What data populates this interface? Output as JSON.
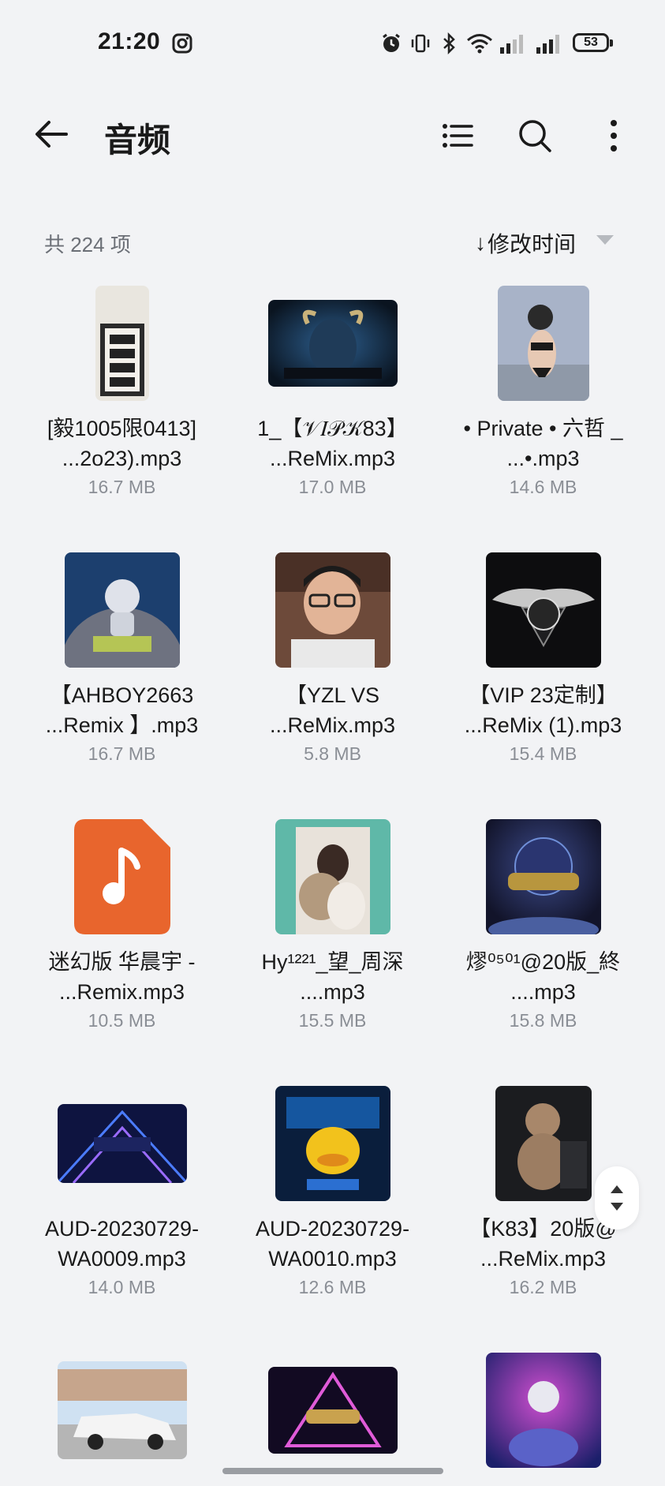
{
  "status": {
    "time": "21:20",
    "battery": "53"
  },
  "header": {
    "title": "音频"
  },
  "list": {
    "count_label": "共 224 项",
    "sort_label": "修改时间",
    "sort_arrow": "↓"
  },
  "items": [
    {
      "line1": "[毅1005限0413]",
      "line2": "...2o23).mp3",
      "size": "16.7 MB",
      "thumb": "photo"
    },
    {
      "line1": "1_【𝒱𝐼𝒫𝒦83】",
      "line2": "...ReMix.mp3",
      "size": "17.0 MB",
      "thumb": "art"
    },
    {
      "line1": "• Private • 六哲 _",
      "line2": "...•.mp3",
      "size": "14.6 MB",
      "thumb": "photo"
    },
    {
      "line1": "【AHBOY2663",
      "line2": "...Remix 】.mp3",
      "size": "16.7 MB",
      "thumb": "art"
    },
    {
      "line1": "【YZL VS",
      "line2": "...ReMix.mp3",
      "size": "5.8 MB",
      "thumb": "photo"
    },
    {
      "line1": "【VIP 23定制】",
      "line2": "...ReMix (1).mp3",
      "size": "15.4 MB",
      "thumb": "art"
    },
    {
      "line1": "迷幻版 华晨宇 -",
      "line2": "...Remix.mp3",
      "size": "10.5 MB",
      "thumb": "music-file-icon"
    },
    {
      "line1": "Hy¹²²¹_望_周深",
      "line2": "....mp3",
      "size": "15.5 MB",
      "thumb": "photo"
    },
    {
      "line1": "熮⁰⁵⁰¹@20版_終",
      "line2": "....mp3",
      "size": "15.8 MB",
      "thumb": "art"
    },
    {
      "line1": "AUD-20230729-",
      "line2": "WA0009.mp3",
      "size": "14.0 MB",
      "thumb": "art"
    },
    {
      "line1": "AUD-20230729-",
      "line2": "WA0010.mp3",
      "size": "12.6 MB",
      "thumb": "art"
    },
    {
      "line1": "【K83】20版@",
      "line2": "...ReMix.mp3",
      "size": "16.2 MB",
      "thumb": "art"
    },
    {
      "line1": "",
      "line2": "",
      "size": "",
      "thumb": "photo"
    },
    {
      "line1": "",
      "line2": "",
      "size": "",
      "thumb": "art"
    },
    {
      "line1": "",
      "line2": "",
      "size": "",
      "thumb": "art"
    }
  ],
  "colors": {
    "background": "#f2f3f5",
    "music_icon": "#e8652d",
    "secondary_text": "#8a8e95"
  }
}
